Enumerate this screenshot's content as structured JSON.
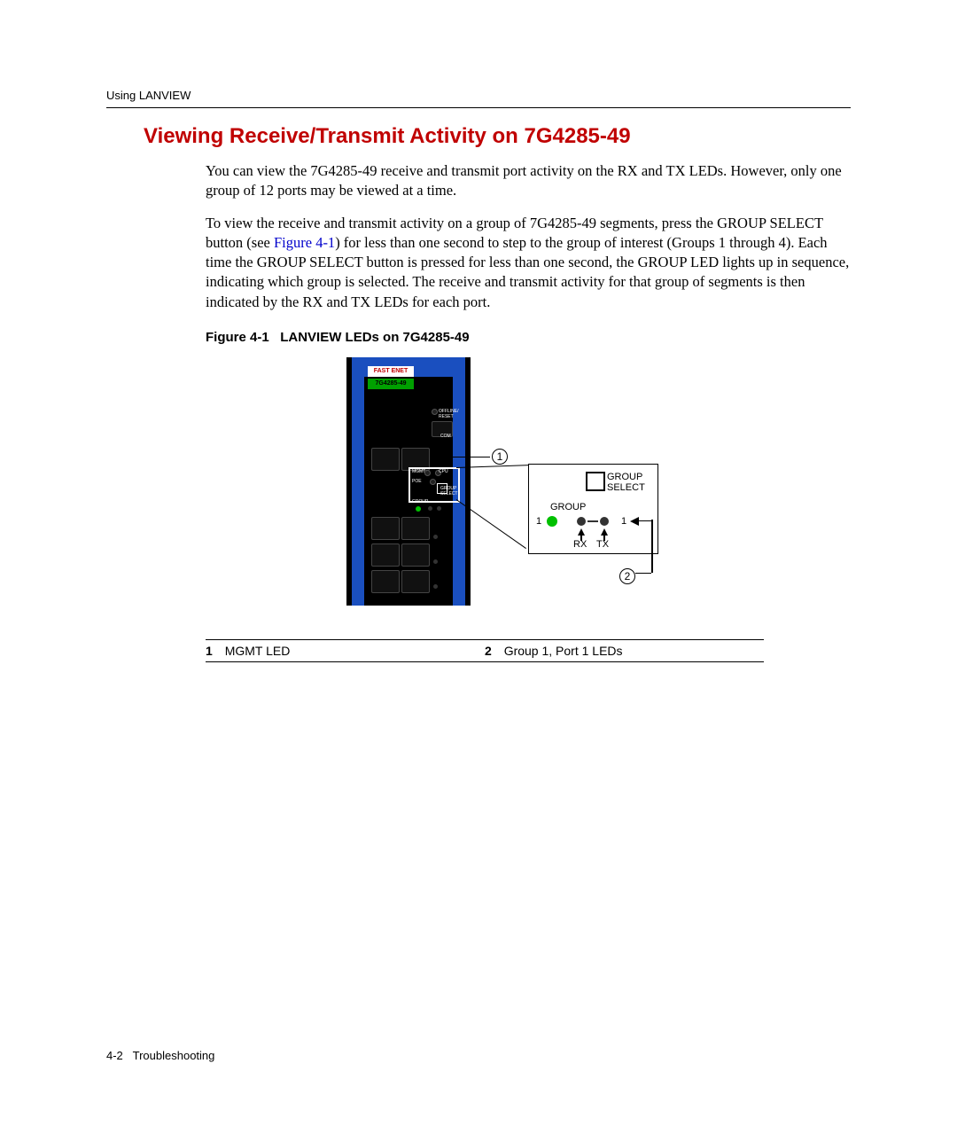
{
  "header": {
    "section": "Using LANVIEW"
  },
  "title": "Viewing Receive/Transmit Activity on 7G4285-49",
  "paragraphs": {
    "p1": "You can view the 7G4285-49 receive and transmit port activity on the RX and TX LEDs. However, only one group of 12 ports may be viewed at a time.",
    "p2a": "To view the receive and transmit activity on a group of 7G4285-49 segments, press the GROUP SELECT button (see ",
    "p2link": "Figure 4-1",
    "p2b": ") for less than one second to step to the group of interest (Groups 1 through 4). Each time the GROUP SELECT button is pressed for less than one second, the GROUP LED lights up in sequence, indicating which group is selected. The receive and transmit activity for that group of segments is then indicated by the RX and TX LEDs for each port."
  },
  "figure": {
    "caption_prefix": "Figure 4-1",
    "caption_title": "LANVIEW LEDs on 7G4285-49",
    "module": {
      "fast_enet": "FAST ENET",
      "model": "7G4285-49",
      "offline_reset": "OFFLINE/\nRESET",
      "com": "COM",
      "mgmt": "MGMT",
      "cpu": "CPU",
      "poe": "POE",
      "group_select_small": "GROUP\nSELECT",
      "group_small": "GROUP"
    },
    "inset": {
      "group_select": "GROUP\nSELECT",
      "group": "GROUP",
      "one_left": "1",
      "one_right": "1",
      "rx": "RX",
      "tx": "TX"
    },
    "balloons": {
      "b1": "1",
      "b2": "2"
    }
  },
  "legend": {
    "n1": "1",
    "t1": "MGMT LED",
    "n2": "2",
    "t2": "Group 1, Port 1 LEDs"
  },
  "footer": {
    "page": "4-2",
    "chapter": "Troubleshooting"
  }
}
